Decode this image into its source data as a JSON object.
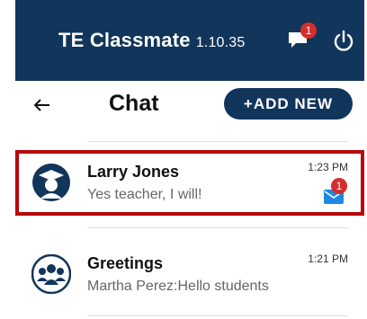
{
  "app": {
    "title": "TE Classmate",
    "version": "1.10.35",
    "chat_badge": "1"
  },
  "header": {
    "back_glyph": "←",
    "title": "Chat",
    "add_label": "+ADD NEW"
  },
  "chats": [
    {
      "name": "Larry Jones",
      "preview": "Yes teacher, I will!",
      "time": "1:23 PM",
      "unread": "1"
    },
    {
      "name": "Greetings",
      "preview": "Martha Perez:Hello students",
      "time": "1:21 PM"
    }
  ],
  "colors": {
    "brand": "#12355b",
    "badge": "#d32f2f",
    "highlight": "#b8060b",
    "mail": "#1e88e5"
  },
  "icons": [
    "chat-icon",
    "power-icon",
    "back-arrow-icon",
    "teacher-avatar-icon",
    "group-avatar-icon",
    "mail-icon"
  ]
}
